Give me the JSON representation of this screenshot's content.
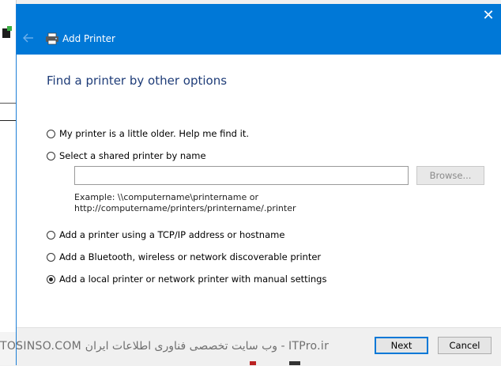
{
  "window": {
    "title": "Add Printer",
    "close_glyph": "✕"
  },
  "page": {
    "heading": "Find a printer by other options"
  },
  "options": [
    {
      "label": "My printer is a little older. Help me find it.",
      "selected": false
    },
    {
      "label": "Select a shared printer by name",
      "selected": false
    },
    {
      "label": "Add a printer using a TCP/IP address or hostname",
      "selected": false
    },
    {
      "label": "Add a Bluetooth, wireless or network discoverable printer",
      "selected": false
    },
    {
      "label": "Add a local printer or network printer with manual settings",
      "selected": true
    }
  ],
  "shared_printer": {
    "value": "",
    "browse_label": "Browse...",
    "example_line1": "Example: \\\\computername\\printername or",
    "example_line2": "http://computername/printers/printername/.printer"
  },
  "footer": {
    "next_label": "Next",
    "cancel_label": "Cancel"
  },
  "watermark": {
    "text": "TOSINSO.COM وب سایت تخصصی فناوری اطلاعات ایران - ITPro.ir"
  },
  "colors": {
    "titlebar": "#0078d7",
    "heading": "#1e3c78"
  },
  "icons": {
    "back": "back-arrow-icon",
    "printer": "printer-icon",
    "close": "close-icon"
  }
}
